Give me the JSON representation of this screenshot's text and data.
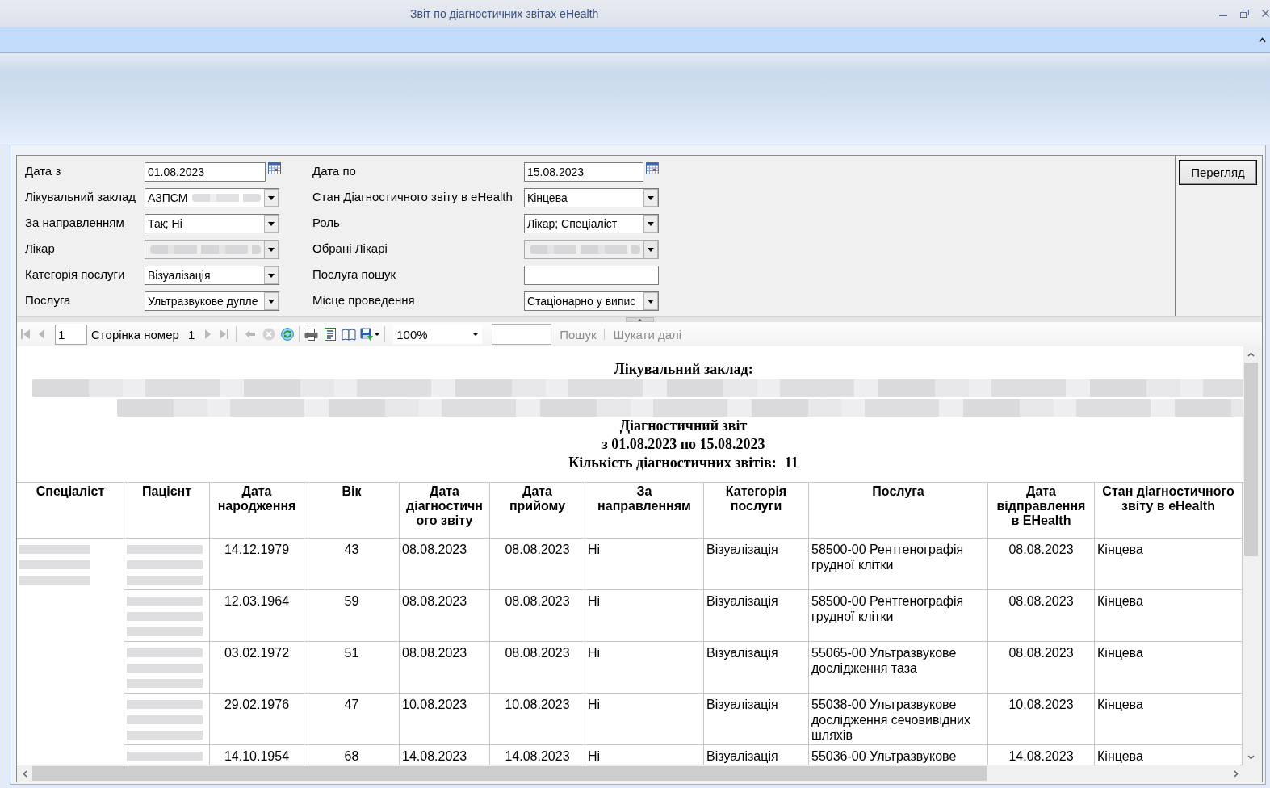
{
  "window": {
    "title": "Звіт по діагностичних звітах eHealth"
  },
  "filters": {
    "column_1": [
      {
        "label": "Дата з",
        "kind": "date",
        "value": "01.08.2023",
        "disabled": false,
        "redacted": false
      },
      {
        "label": "Лікувальний заклад",
        "kind": "combo",
        "value": "АЗПСМ",
        "disabled": false,
        "redacted": true
      },
      {
        "label": "За направленням",
        "kind": "combo",
        "value": "Так; Ні",
        "disabled": false,
        "redacted": false
      },
      {
        "label": "Лікар",
        "kind": "combo",
        "disabled": true,
        "redacted": true
      },
      {
        "label": "Категорія послуги",
        "kind": "combo",
        "value": "Візуалізація",
        "disabled": false,
        "redacted": false
      },
      {
        "label": "Послуга",
        "kind": "combo",
        "value": "Ультразвукове дупле",
        "disabled": false,
        "redacted": false
      }
    ],
    "column_2": [
      {
        "label": "Дата по",
        "kind": "date",
        "value": "15.08.2023",
        "disabled": false,
        "redacted": false
      },
      {
        "label": "Стан Діагностичного звіту в eHealth",
        "kind": "combo",
        "value": "Кінцева",
        "disabled": false,
        "redacted": false
      },
      {
        "label": "Роль",
        "kind": "combo",
        "value": "Лікар; Спеціаліст",
        "disabled": false,
        "redacted": false
      },
      {
        "label": "Обрані Лікарі",
        "kind": "combo",
        "disabled": true,
        "redacted": true
      },
      {
        "label": "Послуга пошук",
        "kind": "text",
        "disabled": false,
        "redacted": false
      },
      {
        "label": "Місце проведення",
        "kind": "combo",
        "value": "Стаціонарно у випис",
        "disabled": false,
        "redacted": false
      }
    ]
  },
  "view_button": {
    "label": "Перегляд"
  },
  "toolbar": {
    "nav_start": [
      {
        "kind": "first",
        "disabled": true
      },
      {
        "kind": "previous",
        "disabled": true
      }
    ],
    "page_field": "1",
    "page_label": "Сторінка номер",
    "page_total": "1",
    "nav_end": [
      {
        "kind": "next",
        "disabled": true
      },
      {
        "kind": "last",
        "disabled": true
      }
    ],
    "history": [
      {
        "kind": "back",
        "disabled": true
      },
      {
        "kind": "stop",
        "disabled": true
      },
      {
        "kind": "refresh",
        "disabled": false
      }
    ],
    "output": [
      {
        "kind": "print",
        "disabled": false
      },
      {
        "kind": "page_setup",
        "disabled": false
      },
      {
        "kind": "print_layout",
        "disabled": false
      },
      {
        "kind": "export",
        "disabled": false
      }
    ],
    "zoom": "100%",
    "find": [
      {
        "label": "Пошук",
        "disabled": true
      },
      {
        "label": "Шукати далі",
        "disabled": true
      }
    ]
  },
  "report": {
    "facility_label": "Лікувальний заклад:",
    "title": "Діагностичний звіт",
    "period": "з 01.08.2023 по 15.08.2023",
    "count_label": "Кількість діагностичних звітів:",
    "count": "11"
  },
  "table": {
    "columns": [
      {
        "label": "Спеціаліст",
        "redacted": true,
        "merged": true
      },
      {
        "label": "Пацієнт",
        "redacted": true,
        "merged": false
      },
      {
        "label": "Дата народження",
        "redacted": false,
        "merged": false
      },
      {
        "label": "Вік",
        "redacted": false,
        "merged": false
      },
      {
        "label": "Дата діагностичного звіту",
        "redacted": false,
        "merged": false
      },
      {
        "label": "Дата прийому",
        "redacted": false,
        "merged": false
      },
      {
        "label": "За направленням",
        "redacted": false,
        "merged": false
      },
      {
        "label": "Категорія послуги",
        "redacted": false,
        "merged": false
      },
      {
        "label": "Послуга",
        "redacted": false,
        "merged": false
      },
      {
        "label": "Дата відправлення в EHealth",
        "redacted": false,
        "merged": false
      },
      {
        "label": "Стан діагностичного звіту в eHealth",
        "redacted": false,
        "merged": false
      }
    ],
    "rows": [
      {
        "cells": [
          "",
          "",
          "14.12.1979",
          "43",
          "08.08.2023",
          "08.08.2023",
          "Ні",
          "Візуалізація",
          "58500-00 Рентгенографія грудної клітки",
          "08.08.2023",
          "Кінцева"
        ]
      },
      {
        "cells": [
          "",
          "",
          "12.03.1964",
          "59",
          "08.08.2023",
          "08.08.2023",
          "Ні",
          "Візуалізація",
          "58500-00 Рентгенографія грудної клітки",
          "08.08.2023",
          "Кінцева"
        ]
      },
      {
        "cells": [
          "",
          "",
          "03.02.1972",
          "51",
          "08.08.2023",
          "08.08.2023",
          "Ні",
          "Візуалізація",
          "55065-00 Ультразвукове дослідження таза",
          "08.08.2023",
          "Кінцева"
        ]
      },
      {
        "cells": [
          "",
          "",
          "29.02.1976",
          "47",
          "10.08.2023",
          "10.08.2023",
          "Ні",
          "Візуалізація",
          "55038-00 Ультразвукове дослідження сечовивідних шляхів",
          "10.08.2023",
          "Кінцева"
        ]
      },
      {
        "cells": [
          "",
          "",
          "14.10.1954",
          "68",
          "14.08.2023",
          "14.08.2023",
          "Ні",
          "Візуалізація",
          "55036-00 Ультразвукове",
          "14.08.2023",
          "Кінцева"
        ]
      }
    ]
  }
}
